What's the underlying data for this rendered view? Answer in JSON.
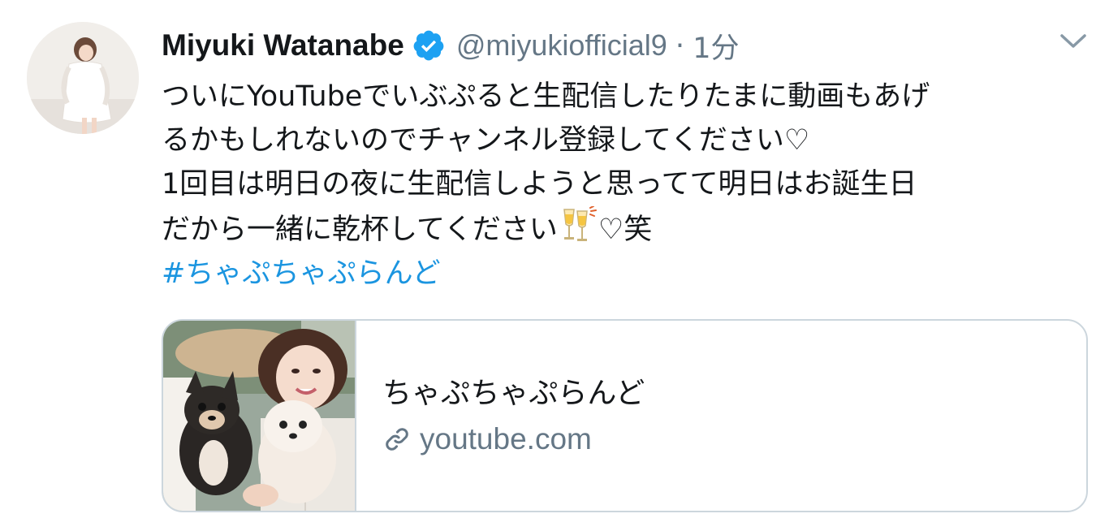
{
  "tweet": {
    "author": {
      "display_name": "Miyuki Watanabe",
      "handle": "@miyukiofficial9",
      "verified": true
    },
    "separator": "·",
    "timestamp": "1分",
    "text_lines": [
      "ついにYouTubeでいぶぷると生配信したりたまに動画もあげ",
      "るかもしれないのでチャンネル登録してください♡",
      "1回目は明日の夜に生配信しようと思ってて明日はお誕生日",
      "だから一緒に乾杯してください"
    ],
    "text_line4_tail": "♡笑",
    "hashtag": "#ちゃぷちゃぷらんど",
    "card": {
      "title": "ちゃぷちゃぷらんど",
      "domain": "youtube.com"
    }
  },
  "icons": {
    "verified": "verified-badge-icon",
    "menu": "chevron-down-icon",
    "emoji": "clinking-glasses-emoji",
    "link": "link-icon"
  },
  "colors": {
    "text": "#14171a",
    "secondary": "#657786",
    "link": "#1b95e0",
    "verified": "#1da1f2",
    "card_border": "#ccd6dd"
  }
}
